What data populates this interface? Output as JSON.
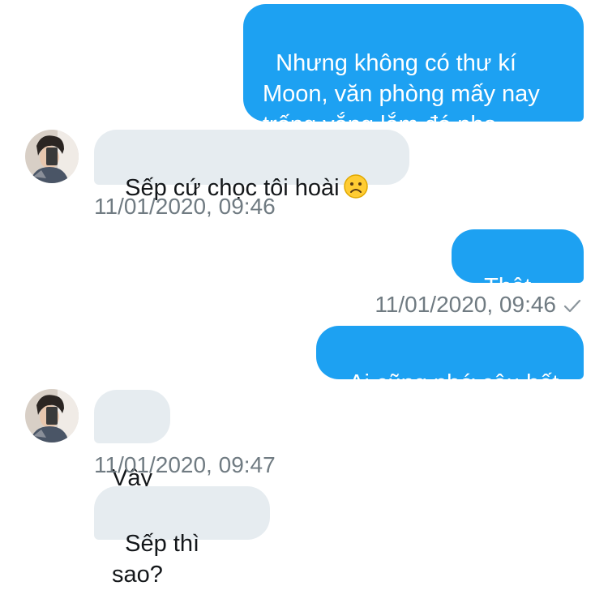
{
  "messages": {
    "m1": {
      "text": "Nhưng không có thư kí\nMoon, văn phòng mấy nay\ntrống vắng lắm đó nha"
    },
    "m2": {
      "text": "Sếp cứ chọc tôi hoài",
      "emoji": "frowning-face"
    },
    "m3": {
      "text": "Thật mà"
    },
    "m4": {
      "text": "Ai cũng nhớ cậu hết"
    },
    "m5": {
      "text": "Vậy"
    },
    "m6": {
      "text": "Sếp thì sao?"
    }
  },
  "timestamps": {
    "t1": "11/01/2020, 09:46",
    "t2": "11/01/2020, 09:46",
    "t3": "11/01/2020, 09:47"
  },
  "status": {
    "read_receipt_icon": "checkmark-icon"
  },
  "colors": {
    "outgoing_bubble": "#1da1f2",
    "incoming_bubble": "#e6ecf0",
    "timestamp_text": "#707b82"
  }
}
